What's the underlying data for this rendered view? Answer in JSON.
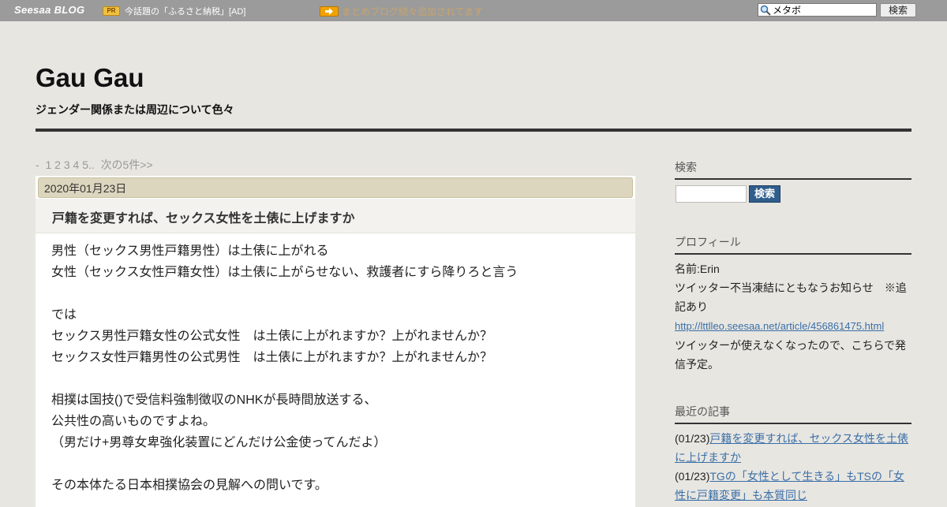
{
  "topbar": {
    "logo_main": "Seesaa",
    "logo_sub": "BLOG",
    "pr_badge": "PR",
    "pr_text": "今話題の「ふるさと納税」[AD]",
    "notice": "まとめブログ続々追加されてます",
    "search_value": "メタボ",
    "search_button": "検索"
  },
  "header": {
    "title": "Gau Gau",
    "description": "ジェンダー関係または周辺について色々"
  },
  "pager": {
    "prefix": "-",
    "pages": [
      "1",
      "2",
      "3",
      "4",
      "5.."
    ],
    "next": "次の5件>>"
  },
  "article": {
    "date": "2020年01月23日",
    "title": "戸籍を変更すれば、セックス女性を土俵に上げますか",
    "lines": [
      "男性（セックス男性戸籍男性）は土俵に上がれる",
      "女性（セックス女性戸籍女性）は土俵に上がらせない、救護者にすら降りろと言う",
      "",
      "では",
      "セックス男性戸籍女性の公式女性　は土俵に上がれますか？上がれませんか？",
      "セックス女性戸籍男性の公式男性　は土俵に上がれますか？上がれませんか？",
      "",
      "相撲は国技()で受信料強制徴収のNHKが長時間放送する、",
      "公共性の高いものですよね。",
      "（男だけ+男尊女卑強化装置にどんだけ公金使ってんだよ）",
      "",
      "その本体たる日本相撲協会の見解への問いです。"
    ]
  },
  "sidebar": {
    "search_heading": "検索",
    "search_button": "検索",
    "profile_heading": "プロフィール",
    "profile_name": "名前:Erin",
    "profile_line1a": "ツイッター不当凍結にともなうお知らせ　※追",
    "profile_line1b": "記あり",
    "profile_link": "http://lttlleo.seesaa.net/article/456861475.html",
    "profile_line2a": "ツイッターが使えなくなったので、こちらで発",
    "profile_line2b": "信予定。",
    "recent_heading": "最近の記事",
    "recent": [
      {
        "date": "(01/23)",
        "title_a": "戸籍を変更すれば、セックス女性を土俵",
        "title_b": "に上げますか"
      },
      {
        "date": "(01/23)",
        "title_a": "TGの「女性として生きる」もTSの「女",
        "title_b": "性に戸籍変更」も本質同じ"
      }
    ]
  }
}
